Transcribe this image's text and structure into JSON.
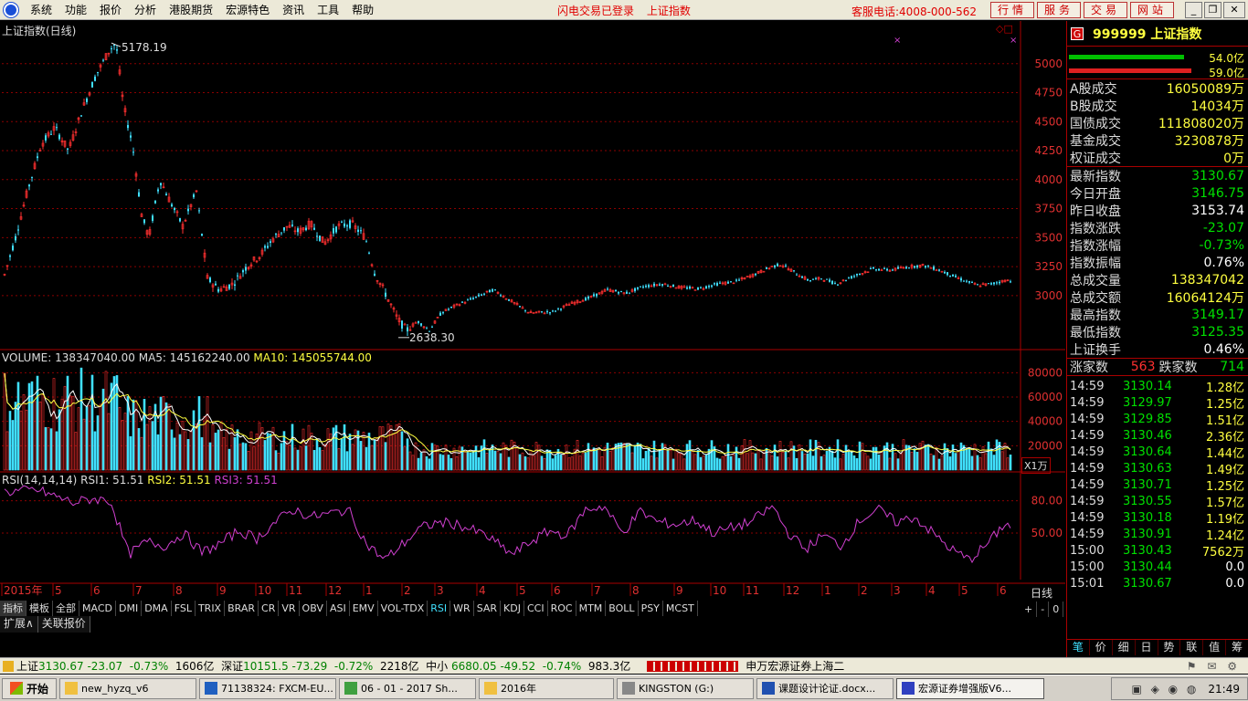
{
  "menubar": {
    "items": [
      "系统",
      "功能",
      "报价",
      "分析",
      "港股期货",
      "宏源特色",
      "资讯",
      "工具",
      "帮助"
    ],
    "status": [
      "闪电交易已登录",
      "上证指数"
    ],
    "hotline": "客服电话:4008-000-562",
    "buttons": [
      "行情",
      "服务",
      "交易",
      "网站"
    ]
  },
  "chart": {
    "title": "上证指数(日线)",
    "price_ticks": [
      "5000",
      "4750",
      "4500",
      "4250",
      "4000",
      "3750",
      "3500",
      "3250",
      "3000"
    ],
    "high_label": "5178.19",
    "low_label": "2638.30",
    "volume_header": {
      "vol": "VOLUME: 138347040.00",
      "ma5": "MA5: 145162240.00",
      "ma10": "MA10: 145055744.00"
    },
    "volume_ticks": [
      "80000",
      "60000",
      "40000",
      "20000"
    ],
    "volume_unit": "X1万",
    "rsi_header": {
      "name": "RSI(14,14,14)",
      "rsi1": "RSI1: 51.51",
      "rsi2": "RSI2: 51.51",
      "rsi3": "RSI3: 51.51"
    },
    "rsi_ticks": [
      "80.00",
      "50.00"
    ],
    "date_axis": [
      "2015年",
      "5",
      "6",
      "7",
      "8",
      "9",
      "10",
      "11",
      "12",
      "1",
      "2",
      "3",
      "4",
      "5",
      "6",
      "7",
      "8",
      "9",
      "10",
      "11",
      "12",
      "1",
      "2",
      "3",
      "4",
      "5",
      "6"
    ],
    "period": "日线"
  },
  "indicator_tabs": [
    "指标",
    "模板",
    "全部",
    "MACD",
    "DMI",
    "DMA",
    "FSL",
    "TRIX",
    "BRAR",
    "CR",
    "VR",
    "OBV",
    "ASI",
    "EMV",
    "VOL-TDX",
    "RSI",
    "WR",
    "SAR",
    "KDJ",
    "CCI",
    "ROC",
    "MTM",
    "BOLL",
    "PSY",
    "MCST"
  ],
  "zoom_controls": [
    "+",
    "-",
    "0"
  ],
  "bottom_tabs": [
    "扩展∧",
    "关联报价"
  ],
  "panel": {
    "badge": "G",
    "code": "999999 上证指数",
    "bar_labels": [
      "54.0亿",
      "59.0亿"
    ],
    "turnover": [
      {
        "k": "A股成交",
        "v": "16050089万"
      },
      {
        "k": "B股成交",
        "v": "14034万"
      },
      {
        "k": "国债成交",
        "v": "111808020万"
      },
      {
        "k": "基金成交",
        "v": "3230878万"
      },
      {
        "k": "权证成交",
        "v": "0万"
      }
    ],
    "quote": [
      {
        "k": "最新指数",
        "v": "3130.67",
        "c": "#00e000"
      },
      {
        "k": "今日开盘",
        "v": "3146.75",
        "c": "#00e000"
      },
      {
        "k": "昨日收盘",
        "v": "3153.74",
        "c": "#ffffff"
      },
      {
        "k": "指数涨跌",
        "v": "-23.07",
        "c": "#00e000"
      },
      {
        "k": "指数涨幅",
        "v": "-0.73%",
        "c": "#00e000"
      },
      {
        "k": "指数振幅",
        "v": "0.76%",
        "c": "#ffffff"
      },
      {
        "k": "总成交量",
        "v": "138347042",
        "c": "#ffff40"
      },
      {
        "k": "总成交额",
        "v": "16064124万",
        "c": "#ffff40"
      },
      {
        "k": "最高指数",
        "v": "3149.17",
        "c": "#00e000"
      },
      {
        "k": "最低指数",
        "v": "3125.35",
        "c": "#00e000"
      },
      {
        "k": "上证换手",
        "v": "0.46%",
        "c": "#ffffff"
      }
    ],
    "breadth": {
      "up_label": "涨家数",
      "up": "563",
      "down_label": "跌家数",
      "down": "714"
    },
    "ticks": [
      {
        "t": "14:59",
        "p": "3130.14",
        "v": "1.28亿",
        "c": "#ffff40"
      },
      {
        "t": "14:59",
        "p": "3129.97",
        "v": "1.25亿",
        "c": "#ffff40"
      },
      {
        "t": "14:59",
        "p": "3129.85",
        "v": "1.51亿",
        "c": "#ffff40"
      },
      {
        "t": "14:59",
        "p": "3130.46",
        "v": "2.36亿",
        "c": "#ffff40"
      },
      {
        "t": "14:59",
        "p": "3130.64",
        "v": "1.44亿",
        "c": "#ffff40"
      },
      {
        "t": "14:59",
        "p": "3130.63",
        "v": "1.49亿",
        "c": "#ffff40"
      },
      {
        "t": "14:59",
        "p": "3130.71",
        "v": "1.25亿",
        "c": "#ffff40"
      },
      {
        "t": "14:59",
        "p": "3130.55",
        "v": "1.57亿",
        "c": "#ffff40"
      },
      {
        "t": "14:59",
        "p": "3130.18",
        "v": "1.19亿",
        "c": "#ffff40"
      },
      {
        "t": "14:59",
        "p": "3130.91",
        "v": "1.24亿",
        "c": "#ffff40"
      },
      {
        "t": "15:00",
        "p": "3130.43",
        "v": "7562万",
        "c": "#ffff40"
      },
      {
        "t": "15:00",
        "p": "3130.44",
        "v": "0.0",
        "c": "#ffffff"
      },
      {
        "t": "15:01",
        "p": "3130.67",
        "v": "0.0",
        "c": "#ffffff"
      }
    ],
    "tabs": [
      "笔",
      "价",
      "细",
      "日",
      "势",
      "联",
      "值",
      "筹"
    ]
  },
  "ticker": {
    "sh_name": "上证",
    "sh_val": "3130.67",
    "sh_chg": "-23.07",
    "sh_pct": "-0.73%",
    "sh_amt": "1606亿",
    "sz_name": "深证",
    "sz_val": "10151.5",
    "sz_chg": "-73.29",
    "sz_pct": "-0.72%",
    "sz_amt": "2218亿",
    "zx_name": "中小",
    "zx_val": "6680.05",
    "zx_chg": "-49.52",
    "zx_pct": "-0.74%",
    "zx_amt": "983.3亿",
    "broker": "申万宏源证券上海二"
  },
  "taskbar": {
    "start": "开始",
    "items": [
      "new_hyzq_v6",
      "71138324: FXCM-EU...",
      "06 - 01 - 2017 Sh...",
      "2016年",
      "KINGSTON (G:)",
      "课题设计论证.docx...",
      "宏源证券增强版V6..."
    ],
    "clock": "21:49"
  },
  "colors": {
    "up": "#ff3030",
    "down": "#40e0ff",
    "ma5": "#ffffff",
    "ma10": "#ffff40",
    "rsi": "#d040d0",
    "grid": "#8b0000"
  }
}
